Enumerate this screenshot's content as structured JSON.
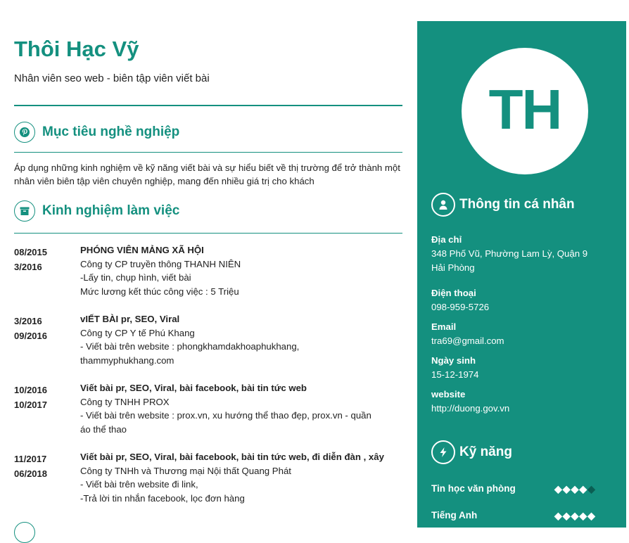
{
  "profile": {
    "name": "Thôi Hạc Vỹ",
    "job_title": "Nhân viên  seo web - biên tập viên viết bài",
    "initials": "TH"
  },
  "objective": {
    "heading": "Mục tiêu nghề nghiệp",
    "icon": "pinterest-icon",
    "text": "Áp dụng những kinh nghiệm về kỹ năng viết bài và sự hiểu biết về thị trường để trở thành một nhân viên biên tập viên chuyên nghiệp, mang đến nhiều giá trị cho khách"
  },
  "experience": {
    "heading": "Kinh nghiệm làm việc",
    "icon": "archive-box-icon",
    "items": [
      {
        "from": "08/2015",
        "to": "3/2016",
        "role": "PHÓNG VIÊN MẢNG XÃ HỘI",
        "company": "Công ty CP truyền thông THANH NIÊN",
        "details": [
          "-Lấy tin, chụp hình, viết bài",
          "Mức lương kết thúc công việc : 5 Triệu"
        ]
      },
      {
        "from": "3/2016",
        "to": "09/2016",
        "role": "vIẾT BÀI pr, SEO, Viral",
        "company": "Công ty CP Y tế Phú Khang",
        "details": [
          "- Viết bài trên website : phongkhamdakhoaphukhang,",
          "thammyphukhang.com"
        ]
      },
      {
        "from": "10/2016",
        "to": "10/2017",
        "role": "Viết bài pr, SEO, Viral, bài facebook, bài tin tức web",
        "company": "Công ty TNHH PROX",
        "details": [
          "- Viết bài trên website : prox.vn, xu hướng thể thao đẹp, prox.vn - quần",
          "áo thể thao"
        ]
      },
      {
        "from": "11/2017",
        "to": "06/2018",
        "role": "Viết bài pr, SEO, Viral, bài facebook, bài tin tức web, đi diễn đàn , xây",
        "company": "Công ty TNHh và Thương mại Nội thất Quang Phát",
        "details": [
          "- Viết bài trên website đi link,",
          "-Trả lời tin nhắn facebook, lọc đơn hàng"
        ]
      }
    ]
  },
  "personal": {
    "heading": "Thông tin cá nhân",
    "icon": "user-icon",
    "address_label": "Địa chỉ",
    "address_line1": "348 Phố Vũ, Phường Lam Lỳ, Quận 9",
    "address_line2": "Hải Phòng",
    "phone_label": "Điện thoại",
    "phone": "098-959-5726",
    "email_label": "Email",
    "email": "tra69@gmail.com",
    "dob_label": "Ngày sinh",
    "dob": "15-12-1974",
    "website_label": "website",
    "website": "http://duong.gov.vn"
  },
  "skills": {
    "heading": "Kỹ năng",
    "icon": "lightning-icon",
    "items": [
      {
        "name": "Tin học văn phòng",
        "level": 4,
        "max": 5
      },
      {
        "name": "Tiếng Anh",
        "level": 5,
        "max": 5
      }
    ]
  },
  "colors": {
    "accent": "#14907f",
    "white": "#ffffff",
    "dot_off": "#0a5e53"
  }
}
